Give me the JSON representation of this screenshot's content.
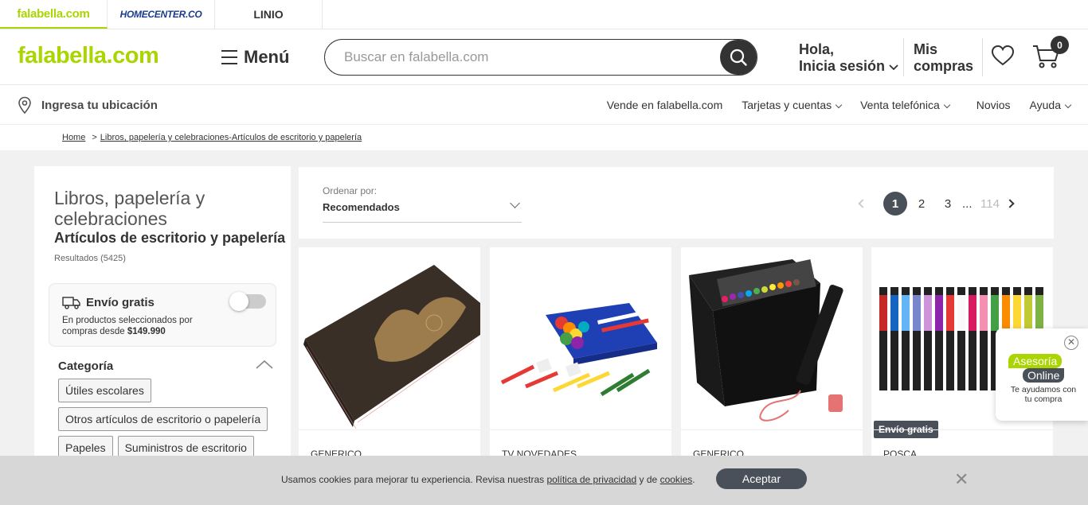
{
  "brand_tabs": [
    {
      "label": "falabella.com",
      "active": true
    },
    {
      "label": "HOMECENTER.CO",
      "active": false
    },
    {
      "label": "LINIO",
      "active": false
    }
  ],
  "header": {
    "logo": "falabella.com",
    "menu_label": "Menú",
    "search_placeholder": "Buscar en falabella.com",
    "login_line1": "Hola,",
    "login_line2": "Inicia sesión",
    "compras_line1": "Mis",
    "compras_line2": "compras",
    "cart_count": "0"
  },
  "subnav": {
    "location": "Ingresa tu ubicación",
    "links": [
      {
        "label": "Vende en falabella.com",
        "dropdown": false
      },
      {
        "label": "Tarjetas y cuentas",
        "dropdown": true
      },
      {
        "label": "Venta telefónica",
        "dropdown": true
      },
      {
        "label": "Novios",
        "dropdown": false
      },
      {
        "label": "Ayuda",
        "dropdown": true
      }
    ]
  },
  "breadcrumb": {
    "home": "Home",
    "separator": ">",
    "current": "Libros, papelería y celebraciones-Artículos de escritorio y papelería"
  },
  "sidebar": {
    "category": "Libros, papelería y celebraciones",
    "subcategory": "Artículos de escritorio y papelería",
    "results": "Resultados (5425)",
    "envio_title": "Envío gratis",
    "envio_text_1": "En productos seleccionados por compras desde ",
    "envio_amount": "$149.990",
    "facet_title": "Categoría",
    "chips": [
      "Útiles escolares",
      "Otros artículos de escritorio o papelería",
      "Papeles",
      "Suministros de escritorio"
    ]
  },
  "sort": {
    "label": "Ordenar por:",
    "value": "Recomendados"
  },
  "pagination": {
    "pages": [
      "1",
      "2",
      "3"
    ],
    "dots": "...",
    "last": "114",
    "current": "1"
  },
  "products": [
    {
      "brand": "GENERICO",
      "badge": ""
    },
    {
      "brand": "TV NOVEDADES",
      "badge": ""
    },
    {
      "brand": "GENERICO",
      "badge": ""
    },
    {
      "brand": "POSCA",
      "badge": "Envío gratis"
    }
  ],
  "chat": {
    "line1": "Asesoría",
    "line2": "Online",
    "text": "Te ayudamos con tu compra"
  },
  "cookie": {
    "text_before": "Usamos cookies para mejorar tu experiencia. Revisa nuestras ",
    "policy_link": "política de privacidad",
    "text_middle": " y de ",
    "cookies_link": "cookies",
    "text_after": ".",
    "accept": "Aceptar"
  },
  "colors": {
    "brand_green": "#aad500",
    "dark_gray": "#4a5059",
    "homecenter_blue": "#1a3b8f",
    "linio_pink": "#e2006a"
  }
}
